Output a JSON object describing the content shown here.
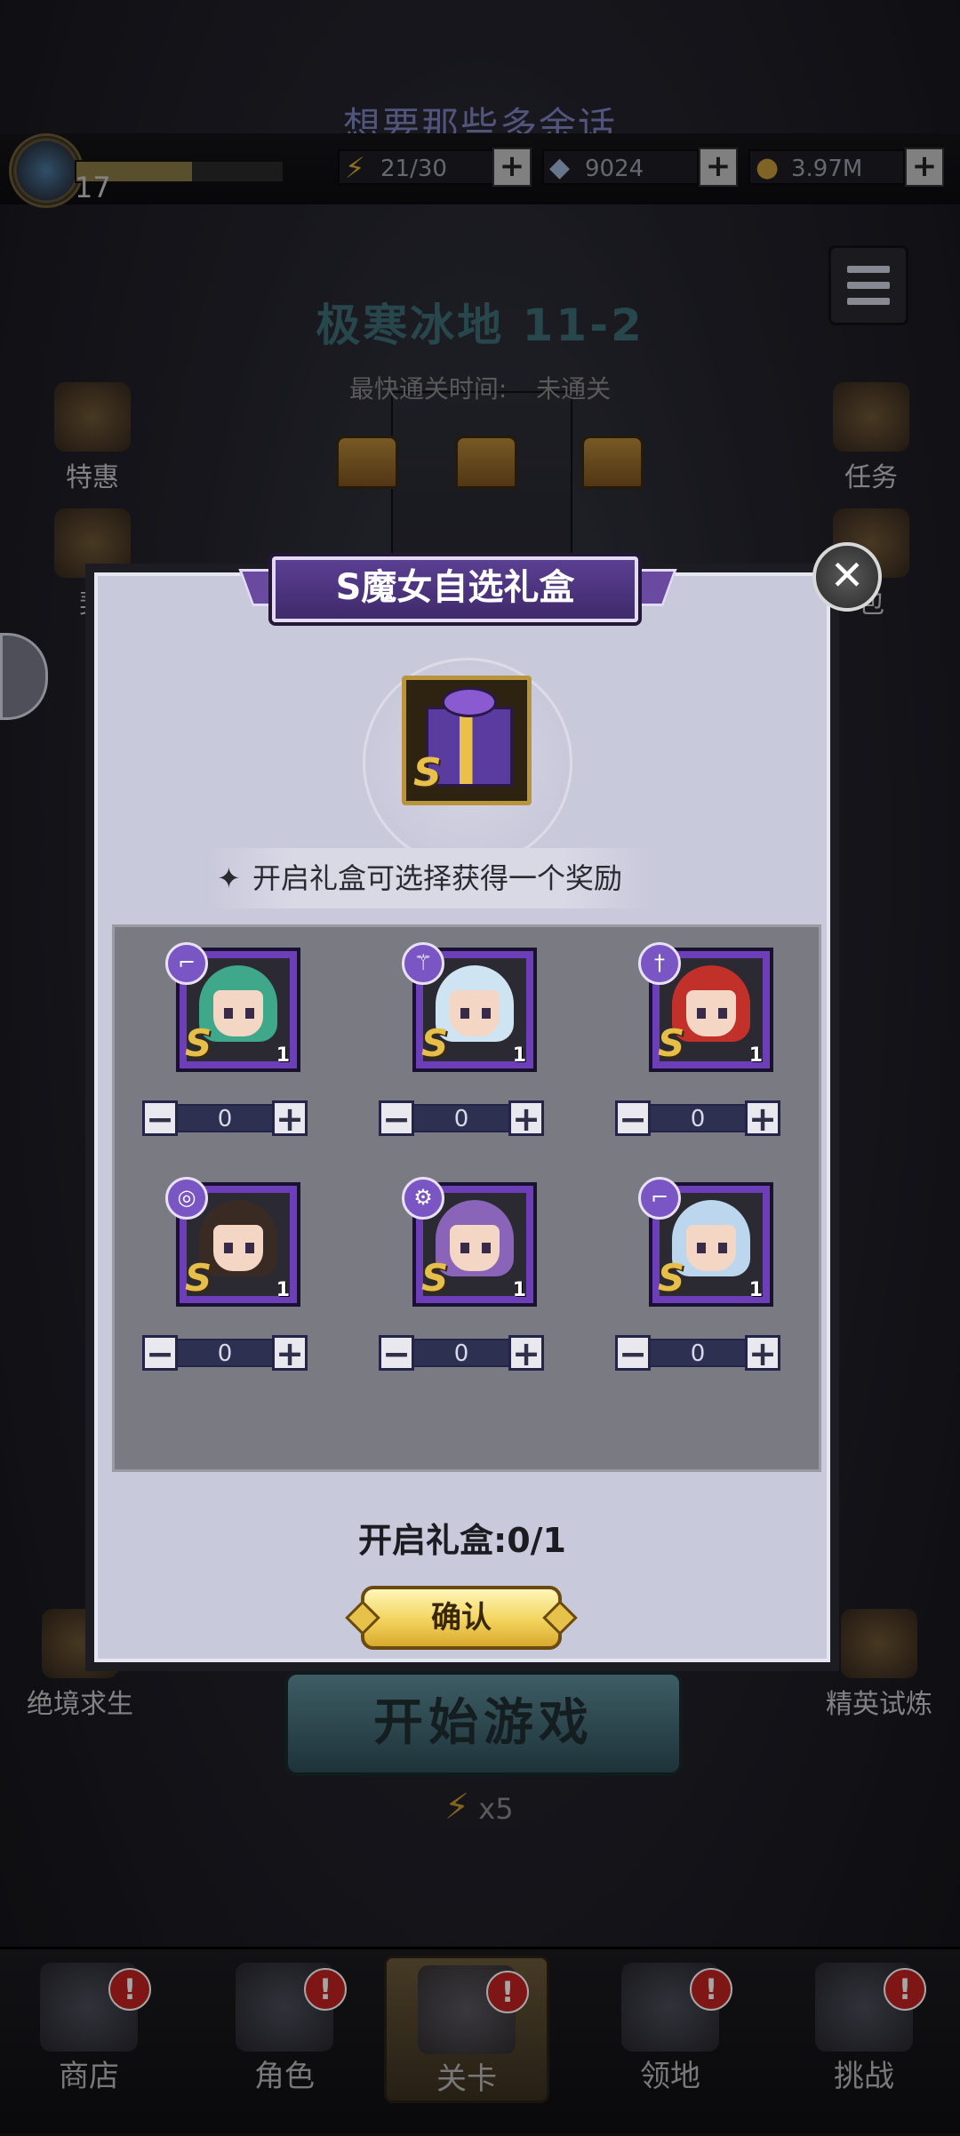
{
  "marquee": "想要那些多余话",
  "player": {
    "level": "17",
    "xp_fraction": 0.56
  },
  "resources": [
    {
      "name": "energy",
      "icon": "lightning-icon",
      "value": "21/30"
    },
    {
      "name": "diamond",
      "icon": "diamond-icon",
      "value": "9024"
    },
    {
      "name": "gold",
      "icon": "coin-icon",
      "value": "3.97M"
    }
  ],
  "plus_label": "+",
  "stage": {
    "title": "极寒冰地 11-2",
    "fastest_label": "最快通关时间:",
    "fastest_value": "未通关"
  },
  "left_side": [
    {
      "label": "特惠"
    },
    {
      "label": "契"
    },
    {
      "label": "绝境求生"
    }
  ],
  "right_side": [
    {
      "label": "任务"
    },
    {
      "label": "包"
    },
    {
      "label": "精英试炼"
    }
  ],
  "start_button": "开始游戏",
  "energy_cost": "x5",
  "nav": [
    {
      "label": "商店",
      "badge": "!"
    },
    {
      "label": "角色",
      "badge": "!"
    },
    {
      "label": "关卡",
      "badge": "!"
    },
    {
      "label": "领地",
      "badge": "!"
    },
    {
      "label": "挑战",
      "badge": "!"
    }
  ],
  "dialog": {
    "title": "S魔女自选礼盒",
    "close": "✕",
    "gift_grade": "S",
    "hint": "开启礼盒可选择获得一个奖励",
    "hint_icon": "✦",
    "open_progress": "开启礼盒:0/1",
    "confirm": "确认",
    "rewards": [
      {
        "grade": "S",
        "count": "1",
        "quantity": "0",
        "minus": "−",
        "plus": "+",
        "class_icon": "rifle-icon",
        "hair": "#3fa88a"
      },
      {
        "grade": "S",
        "count": "1",
        "quantity": "0",
        "minus": "−",
        "plus": "+",
        "class_icon": "staff-icon",
        "hair": "#cfe4f2"
      },
      {
        "grade": "S",
        "count": "1",
        "quantity": "0",
        "minus": "−",
        "plus": "+",
        "class_icon": "sword-icon",
        "hair": "#c2302a"
      },
      {
        "grade": "S",
        "count": "1",
        "quantity": "0",
        "minus": "−",
        "plus": "+",
        "class_icon": "swirl-icon",
        "hair": "#3a2a24"
      },
      {
        "grade": "S",
        "count": "1",
        "quantity": "0",
        "minus": "−",
        "plus": "+",
        "class_icon": "gear-icon",
        "hair": "#8a64b8"
      },
      {
        "grade": "S",
        "count": "1",
        "quantity": "0",
        "minus": "−",
        "plus": "+",
        "class_icon": "rifle-icon",
        "hair": "#bcd6ee"
      }
    ]
  }
}
